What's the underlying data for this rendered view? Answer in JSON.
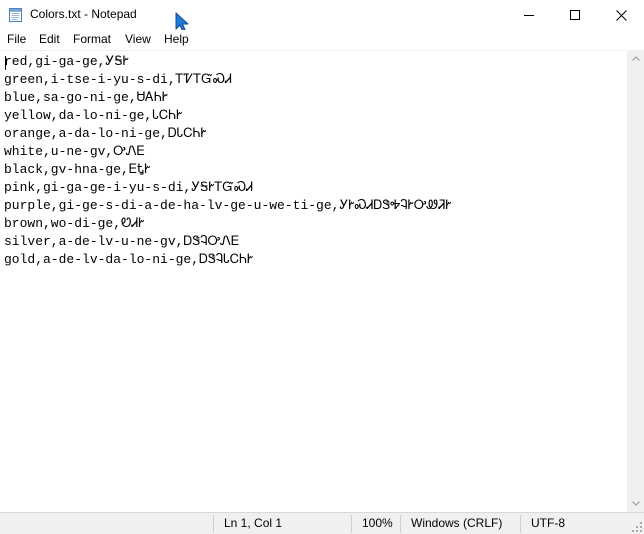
{
  "window": {
    "title": "Colors.txt - Notepad",
    "app_icon": "notepad-icon"
  },
  "window_controls": {
    "minimize_icon": "minimize-icon",
    "maximize_icon": "maximize-icon",
    "close_icon": "close-icon"
  },
  "menubar": {
    "items": [
      "File",
      "Edit",
      "Format",
      "View",
      "Help"
    ]
  },
  "editor": {
    "lines": [
      "red,gi-ga-ge,ᎩᎦᎨ",
      "green,i-tse-i-yu-s-di,ᎢᏤᎢᏳᏍᏗ",
      "blue,sa-go-ni-ge,ᏌᎪᏂᎨ",
      "yellow,da-lo-ni-ge,ᏓᏟᏂᎨ",
      "orange,a-da-lo-ni-ge,ᎠᏓᏟᏂᎨ",
      "white,u-ne-gv,ᎤᏁᎬ",
      "black,gv-hna-ge,ᎬᎿᎨ",
      "pink,gi-ga-ge-i-yu-s-di,ᎩᎦᎨᎢᏳᏍᏗ",
      "purple,gi-ge-s-di-a-de-ha-lv-ge-u-we-ti-ge,ᎩᎨᏍᏗᎠᏕᎭᎸᎨᎤᏪᏘᎨ",
      "brown,wo-di-ge,ᏬᏗᎨ",
      "silver,a-de-lv-u-ne-gv,ᎠᏕᎸᎤᏁᎬ",
      "gold,a-de-lv-da-lo-ni-ge,ᎠᏕᎸᏓᏟᏂᎨ"
    ]
  },
  "statusbar": {
    "position": "Ln 1, Col 1",
    "zoom": "100%",
    "line_ending": "Windows (CRLF)",
    "encoding": "UTF-8"
  },
  "colors": {
    "background": "#ffffff",
    "chrome": "#f0f0f0",
    "text": "#000000",
    "pointer": "#1e7bd6"
  }
}
